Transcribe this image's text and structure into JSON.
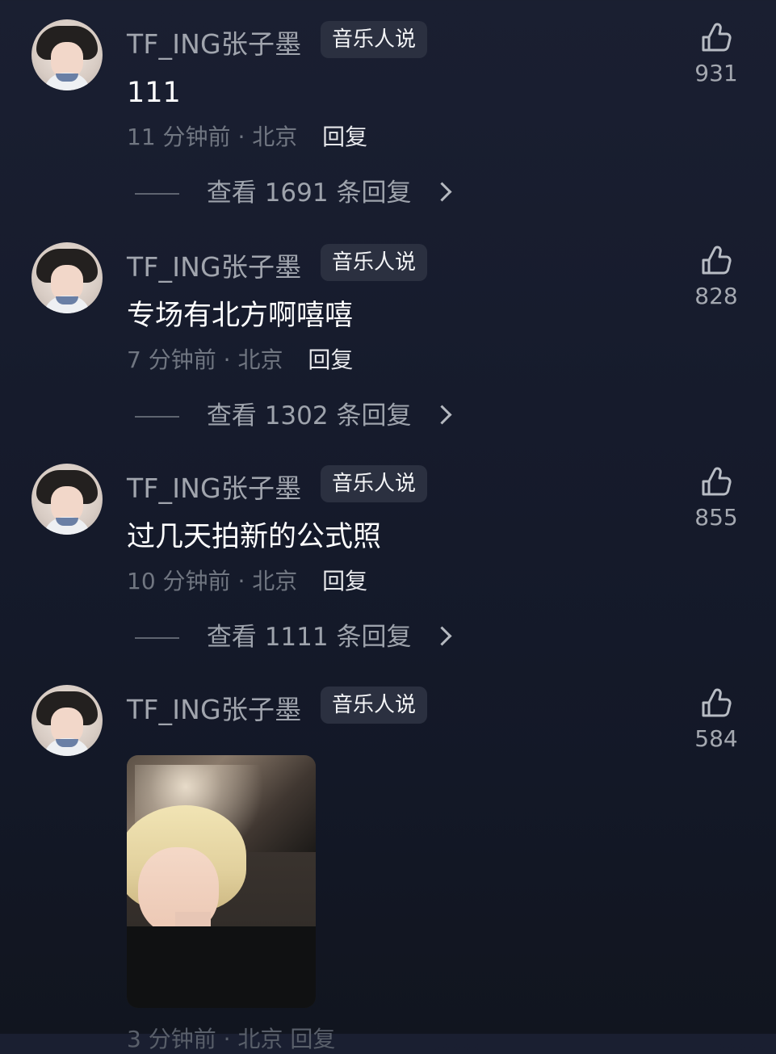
{
  "comments": [
    {
      "username": "TF_ING张子墨",
      "badge": "音乐人说",
      "content": "111",
      "time": "11 分钟前",
      "location": "北京",
      "reply_label": "回复",
      "thread_label": "查看 1691 条回复",
      "likes": "931"
    },
    {
      "username": "TF_ING张子墨",
      "badge": "音乐人说",
      "content": "专场有北方啊嘻嘻",
      "time": "7 分钟前",
      "location": "北京",
      "reply_label": "回复",
      "thread_label": "查看 1302 条回复",
      "likes": "828"
    },
    {
      "username": "TF_ING张子墨",
      "badge": "音乐人说",
      "content": "过几天拍新的公式照",
      "time": "10 分钟前",
      "location": "北京",
      "reply_label": "回复",
      "thread_label": "查看 1111 条回复",
      "likes": "855"
    },
    {
      "username": "TF_ING张子墨",
      "badge": "音乐人说",
      "likes": "584",
      "footer_partial": "3 分钟前 · 北京   回复"
    }
  ]
}
